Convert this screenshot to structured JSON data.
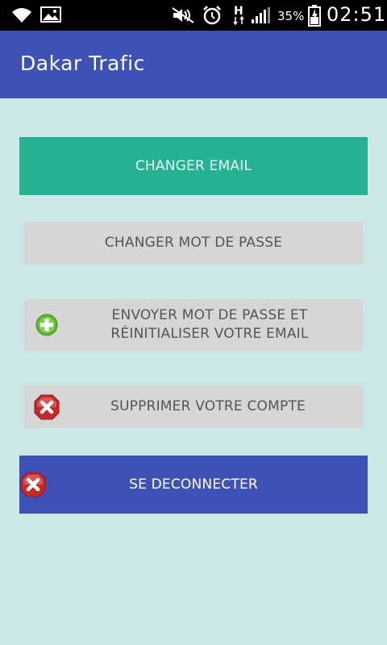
{
  "status_bar": {
    "battery_percent": "35%",
    "time": "02:51",
    "network_type": "H",
    "icons": [
      "wifi-icon",
      "image-icon",
      "mute-icon",
      "alarm-icon",
      "network-h-icon",
      "signal-icon",
      "battery-icon"
    ]
  },
  "app_bar": {
    "title": "Dakar Trafic"
  },
  "buttons": {
    "change_email": "CHANGER EMAIL",
    "change_password": "CHANGER MOT DE PASSE",
    "send_password_line1": "ENVOYER MOT DE PASSE ET",
    "send_password_line2": "RÉINITIALISER VOTRE EMAIL",
    "delete_account": "SUPPRIMER VOTRE COMPTE",
    "logout": "SE DECONNECTER"
  },
  "colors": {
    "app_bar": "#3f51b5",
    "background": "#cbe8e6",
    "primary_teal": "#25b192",
    "gray_button": "#d6d6d6",
    "add_icon": "#5cb82e",
    "delete_icon": "#d32f2f"
  }
}
